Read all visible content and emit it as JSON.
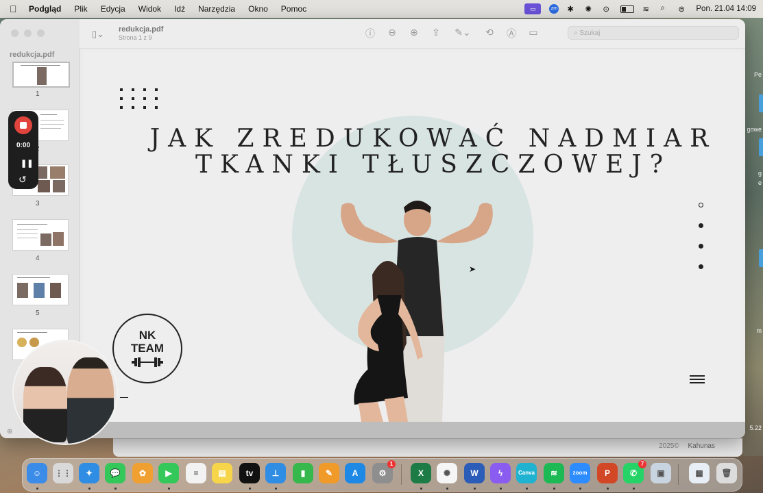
{
  "menubar": {
    "app": "Podgląd",
    "items": [
      "Plik",
      "Edycja",
      "Widok",
      "Idź",
      "Narzędzia",
      "Okno",
      "Pomoc"
    ],
    "datetime": "Pon. 21.04  14:09",
    "zoom_badge": "zm"
  },
  "window": {
    "sidebar_filename": "redukcja.pdf",
    "doc_title": "redukcja.pdf",
    "doc_subtitle": "Strona 1 z 9",
    "search_placeholder": "Szukaj",
    "thumbnails": [
      {
        "num": "1"
      },
      {
        "num": "2"
      },
      {
        "num": "3"
      },
      {
        "num": "4"
      },
      {
        "num": "5"
      }
    ],
    "current_page": 1,
    "total_pages": 9
  },
  "slide": {
    "headline_line1": "JAK ZREDUKOWAĆ NADMIAR",
    "headline_line2": "TKANKI TŁUSZCZOWEJ?",
    "logo_line1": "NK",
    "logo_line2": "TEAM"
  },
  "recorder": {
    "time": "0:00"
  },
  "background_window": {
    "year": "2025©",
    "author": "Kahunas"
  },
  "desktop_right_labels": [
    "Pe",
    "gowe",
    "g",
    "e",
    "m",
    "5.22"
  ],
  "dock": {
    "apps": [
      {
        "name": "Finder",
        "color": "#3b8be8",
        "glyph": "☺"
      },
      {
        "name": "Launchpad",
        "color": "#d9d9d9",
        "glyph": "⋮⋮"
      },
      {
        "name": "Safari",
        "color": "#2f8de4",
        "glyph": "✦"
      },
      {
        "name": "Wiadomości",
        "color": "#34c759",
        "glyph": "💬"
      },
      {
        "name": "Zdjęcia",
        "color": "#f0a030",
        "glyph": "✿"
      },
      {
        "name": "FaceTime",
        "color": "#34c759",
        "glyph": "▶"
      },
      {
        "name": "Przypomnienia",
        "color": "#f2f2f2",
        "glyph": "≡"
      },
      {
        "name": "Notatki",
        "color": "#f7d54a",
        "glyph": "▤"
      },
      {
        "name": "TV",
        "color": "#111111",
        "glyph": "tv"
      },
      {
        "name": "Keynote",
        "color": "#2f8de4",
        "glyph": "⊥"
      },
      {
        "name": "Numbers",
        "color": "#36b84c",
        "glyph": "▮"
      },
      {
        "name": "Pages",
        "color": "#f09a2a",
        "glyph": "✎"
      },
      {
        "name": "App Store",
        "color": "#1e88e5",
        "glyph": "A"
      },
      {
        "name": "Ustawienia",
        "color": "#8e8e8e",
        "glyph": "⚙"
      },
      {
        "name": "Excel",
        "color": "#1d7b45",
        "glyph": "X"
      },
      {
        "name": "ChatGPT",
        "color": "#f5f5f5",
        "glyph": "✺"
      },
      {
        "name": "Word",
        "color": "#2b5cb8",
        "glyph": "W"
      },
      {
        "name": "Messenger",
        "color": "#8a5cf0",
        "glyph": "ϟ"
      },
      {
        "name": "Canva",
        "color": "#1fb3d1",
        "glyph": "Canva"
      },
      {
        "name": "Spotify",
        "color": "#1db954",
        "glyph": "≋"
      },
      {
        "name": "Zoom",
        "color": "#2d8cff",
        "glyph": "zoom"
      },
      {
        "name": "PowerPoint",
        "color": "#d24726",
        "glyph": "P"
      },
      {
        "name": "WhatsApp",
        "color": "#25d366",
        "glyph": "✆"
      },
      {
        "name": "Podgląd",
        "color": "#c8d4e0",
        "glyph": "▣"
      },
      {
        "name": "Folder",
        "color": "#e8eef5",
        "glyph": "▦"
      },
      {
        "name": "Kosz",
        "color": "#dcdcdc",
        "glyph": "🗑"
      }
    ],
    "badges": {
      "Ustawienia": "1",
      "WhatsApp": "7"
    }
  }
}
